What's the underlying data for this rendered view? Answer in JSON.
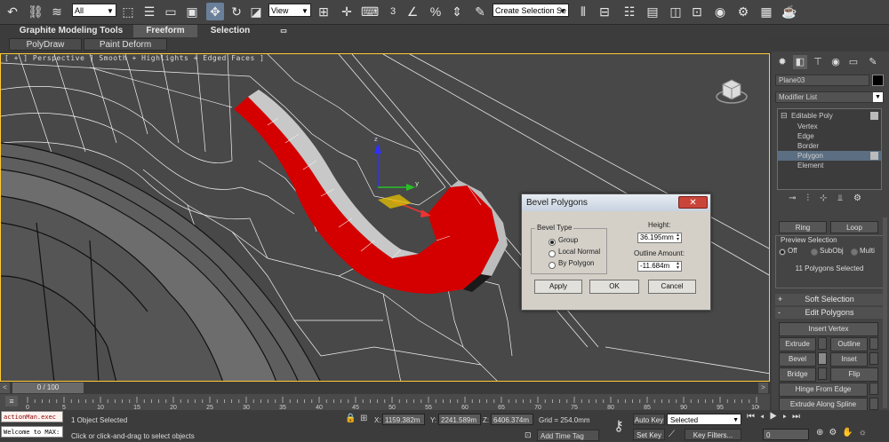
{
  "toolbar": {
    "selection_filter": "All",
    "reference_coord": "View",
    "named_selection": "Create Selection Se",
    "snap_label": "3",
    "icons": [
      "undo-icon",
      "redo-icon",
      "link-icon",
      "unlink-icon",
      "bind-space-warp-icon",
      "select-object-icon",
      "select-by-name-icon",
      "rect-selection-icon",
      "window-crossing-icon",
      "move-icon",
      "rotate-icon",
      "scale-icon",
      "pivot-icon",
      "manipulate-icon",
      "keyboard-shortcut-icon",
      "snap-icon",
      "angle-snap-icon",
      "percent-snap-icon",
      "spinner-snap-icon",
      "edit-named-sets-icon",
      "mirror-icon",
      "align-icon",
      "layer-icon",
      "graphite-icon",
      "curve-editor-icon",
      "schematic-icon",
      "material-editor-icon",
      "render-setup-icon",
      "rendered-frame-icon",
      "render-icon"
    ]
  },
  "ribbon": {
    "tabs": [
      "Graphite Modeling Tools",
      "Freeform",
      "Selection"
    ],
    "active_tab": "Freeform",
    "subtabs": [
      "PolyDraw",
      "Paint Deform"
    ]
  },
  "viewport": {
    "label": "[ + ] Perspective ] Smooth + Highlights + Edged Faces ]",
    "viewcube": "viewcube-icon"
  },
  "command_panel": {
    "object_name": "Plane03",
    "object_color": "#000000",
    "modifier_list": "Modifier List",
    "stack": [
      "Editable Poly",
      "Vertex",
      "Edge",
      "Border",
      "Polygon",
      "Element"
    ],
    "selected_stack_item": "Polygon",
    "ring_label": "Ring",
    "loop_label": "Loop",
    "preview_selection": {
      "title": "Preview Selection",
      "options": [
        "Off",
        "SubObj",
        "Multi"
      ],
      "selected": "Off"
    },
    "selection_info": "11 Polygons Selected",
    "soft_selection": "Soft Selection",
    "edit_polygons": "Edit Polygons",
    "buttons": {
      "insert_vertex": "Insert Vertex",
      "extrude": "Extrude",
      "outline": "Outline",
      "bevel": "Bevel",
      "inset": "Inset",
      "bridge": "Bridge",
      "flip": "Flip",
      "hinge": "Hinge From Edge",
      "extrude_spline": "Extrude Along Spline"
    },
    "rollup_toggles": {
      "soft": "+",
      "edit": "-"
    }
  },
  "dialog": {
    "title": "Bevel Polygons",
    "bevel_type_label": "Bevel Type",
    "options": [
      "Group",
      "Local Normal",
      "By Polygon"
    ],
    "selected_option": "Group",
    "height_label": "Height:",
    "height_value": "36.195mm",
    "outline_label": "Outline Amount:",
    "outline_value": "-11.684m",
    "apply": "Apply",
    "ok": "OK",
    "cancel": "Cancel"
  },
  "timeline": {
    "frame": "0 / 100",
    "ticks": [
      "0",
      "5",
      "10",
      "15",
      "20",
      "25",
      "30",
      "35",
      "40",
      "45",
      "50",
      "55",
      "60",
      "65",
      "70",
      "75",
      "80",
      "85",
      "90",
      "95",
      "100"
    ]
  },
  "status": {
    "maxscript_1": "actionMan.exec",
    "maxscript_2": "Welcome to MAX:",
    "objects_selected": "1 Object Selected",
    "prompt": "Click or click-and-drag to select objects",
    "x_label": "X:",
    "x_value": "1159.382m",
    "y_label": "Y:",
    "y_value": "2241.589m",
    "z_label": "Z:",
    "z_value": "6406.374m",
    "grid": "Grid = 254.0mm",
    "add_time_tag": "Add Time Tag",
    "auto_key": "Auto Key",
    "auto_key_mode": "Selected",
    "set_key": "Set Key",
    "key_filters": "Key Filters...",
    "current_frame": "0"
  }
}
